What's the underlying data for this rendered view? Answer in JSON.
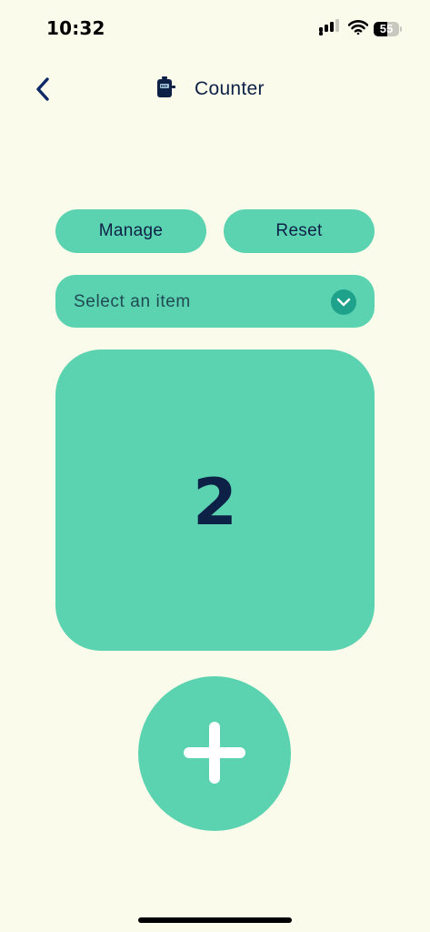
{
  "status_bar": {
    "time": "10:32",
    "battery_level": "55",
    "battery_fraction": 0.55,
    "icons": [
      "cellular-signal-icon",
      "wifi-icon",
      "battery-icon"
    ]
  },
  "nav": {
    "title": "Counter",
    "back_icon": "chevron-left-icon",
    "title_icon": "counter-device-icon"
  },
  "actions": {
    "manage_label": "Manage",
    "reset_label": "Reset"
  },
  "select": {
    "placeholder": "Select an item",
    "icon": "chevron-down-circle-icon"
  },
  "counter": {
    "value": "2"
  },
  "increment": {
    "icon": "plus-icon"
  },
  "colors": {
    "background": "#fbfbeb",
    "accent": "#5cd3b0",
    "accent_dark": "#1fa28c",
    "text": "#0d2147"
  }
}
